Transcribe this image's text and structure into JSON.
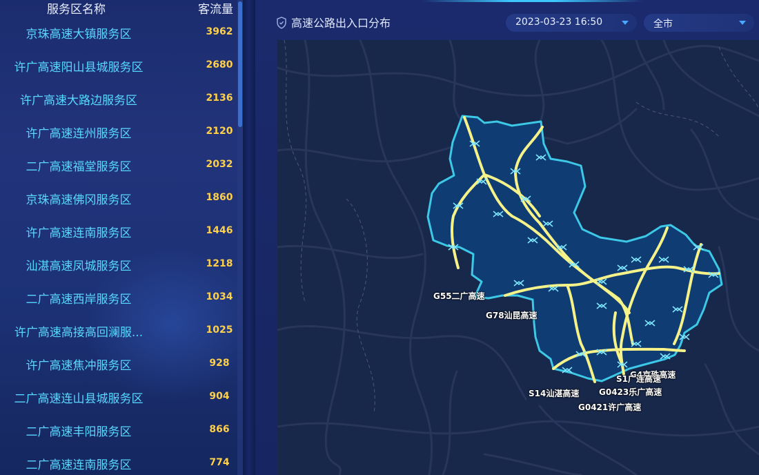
{
  "list": {
    "header_name": "服务区名称",
    "header_count": "客流量",
    "rows": [
      {
        "name": "京珠高速大镇服务区",
        "count": "3962"
      },
      {
        "name": "许广高速阳山县城服务区",
        "count": "2680"
      },
      {
        "name": "许广高速大路边服务区",
        "count": "2136"
      },
      {
        "name": "许广高速连州服务区",
        "count": "2120"
      },
      {
        "name": "二广高速福堂服务区",
        "count": "2032"
      },
      {
        "name": "京珠高速佛冈服务区",
        "count": "1860"
      },
      {
        "name": "许广高速连南服务区",
        "count": "1446"
      },
      {
        "name": "汕湛高速凤城服务区",
        "count": "1218"
      },
      {
        "name": "二广高速西岸服务区",
        "count": "1034"
      },
      {
        "name": "许广高速高接高回澜服...",
        "count": "1025"
      },
      {
        "name": "许广高速焦冲服务区",
        "count": "928"
      },
      {
        "name": "二广高速连山县城服务区",
        "count": "904"
      },
      {
        "name": "二广高速丰阳服务区",
        "count": "866"
      },
      {
        "name": "二广高速连南服务区",
        "count": "774"
      }
    ]
  },
  "map_panel": {
    "title": "高速公路出入口分布",
    "time_value": "2023-03-23 16:50",
    "city_value": "全市",
    "road_labels": [
      "G55二广高速",
      "G78汕昆高速",
      "G4京珠高速",
      "S1广连高速",
      "S14汕湛高速",
      "G0423乐广高速",
      "G0421许广高速"
    ]
  },
  "colors": {
    "name_text": "#59d8ff",
    "count_text": "#ffd04a",
    "highway": "#f5f28a",
    "region_border": "#3cc8e6",
    "region_fill": "#0e3b72",
    "map_bg": "#18284b"
  },
  "icons": [
    "shield-icon",
    "chevron-down-icon",
    "interchange-icon"
  ]
}
